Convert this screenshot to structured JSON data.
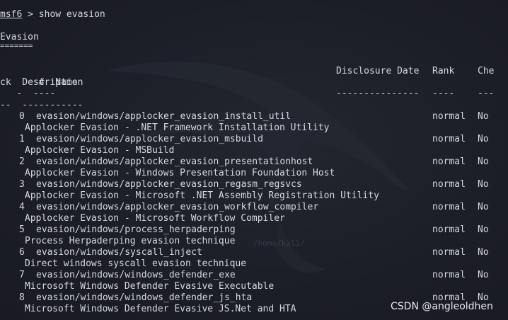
{
  "terminal": {
    "prompt_label": "msf6",
    "prompt_symbol": " > ",
    "command": "show evasion",
    "section_title": "Evasion",
    "section_rule": "=======",
    "header1_left": "   #  Name",
    "header1_disclosure": "Disclosure Date",
    "header1_rank": "Rank",
    "header1_check_a": "Che",
    "header2": "ck  Description",
    "dash1_left": "   -  ----",
    "dash1_disclosure": "---------------",
    "dash1_rank": "----",
    "dash1_check": "---",
    "dash2": "--  -----------",
    "background_path": "/home/kali/"
  },
  "modules": [
    {
      "num": "0",
      "name": "evasion/windows/applocker_evasion_install_util",
      "rank": "normal",
      "check": "No",
      "description": "Applocker Evasion - .NET Framework Installation Utility"
    },
    {
      "num": "1",
      "name": "evasion/windows/applocker_evasion_msbuild",
      "rank": "normal",
      "check": "No",
      "description": "Applocker Evasion - MSBuild"
    },
    {
      "num": "2",
      "name": "evasion/windows/applocker_evasion_presentationhost",
      "rank": "normal",
      "check": "No",
      "description": "Applocker Evasion - Windows Presentation Foundation Host"
    },
    {
      "num": "3",
      "name": "evasion/windows/applocker_evasion_regasm_regsvcs",
      "rank": "normal",
      "check": "No",
      "description": "Applocker Evasion - Microsoft .NET Assembly Registration Utility"
    },
    {
      "num": "4",
      "name": "evasion/windows/applocker_evasion_workflow_compiler",
      "rank": "normal",
      "check": "No",
      "description": "Applocker Evasion - Microsoft Workflow Compiler"
    },
    {
      "num": "5",
      "name": "evasion/windows/process_herpaderping",
      "rank": "normal",
      "check": "No",
      "description": "Process Herpaderping evasion technique"
    },
    {
      "num": "6",
      "name": "evasion/windows/syscall_inject",
      "rank": "normal",
      "check": "No",
      "description": "Direct windows syscall evasion technique"
    },
    {
      "num": "7",
      "name": "evasion/windows/windows_defender_exe",
      "rank": "normal",
      "check": "No",
      "description": "Microsoft Windows Defender Evasive Executable"
    },
    {
      "num": "8",
      "name": "evasion/windows/windows_defender_js_hta",
      "rank": "normal",
      "check": "No",
      "description": "Microsoft Windows Defender Evasive JS.Net and HTA"
    }
  ],
  "watermark": "CSDN @angleoldhen"
}
